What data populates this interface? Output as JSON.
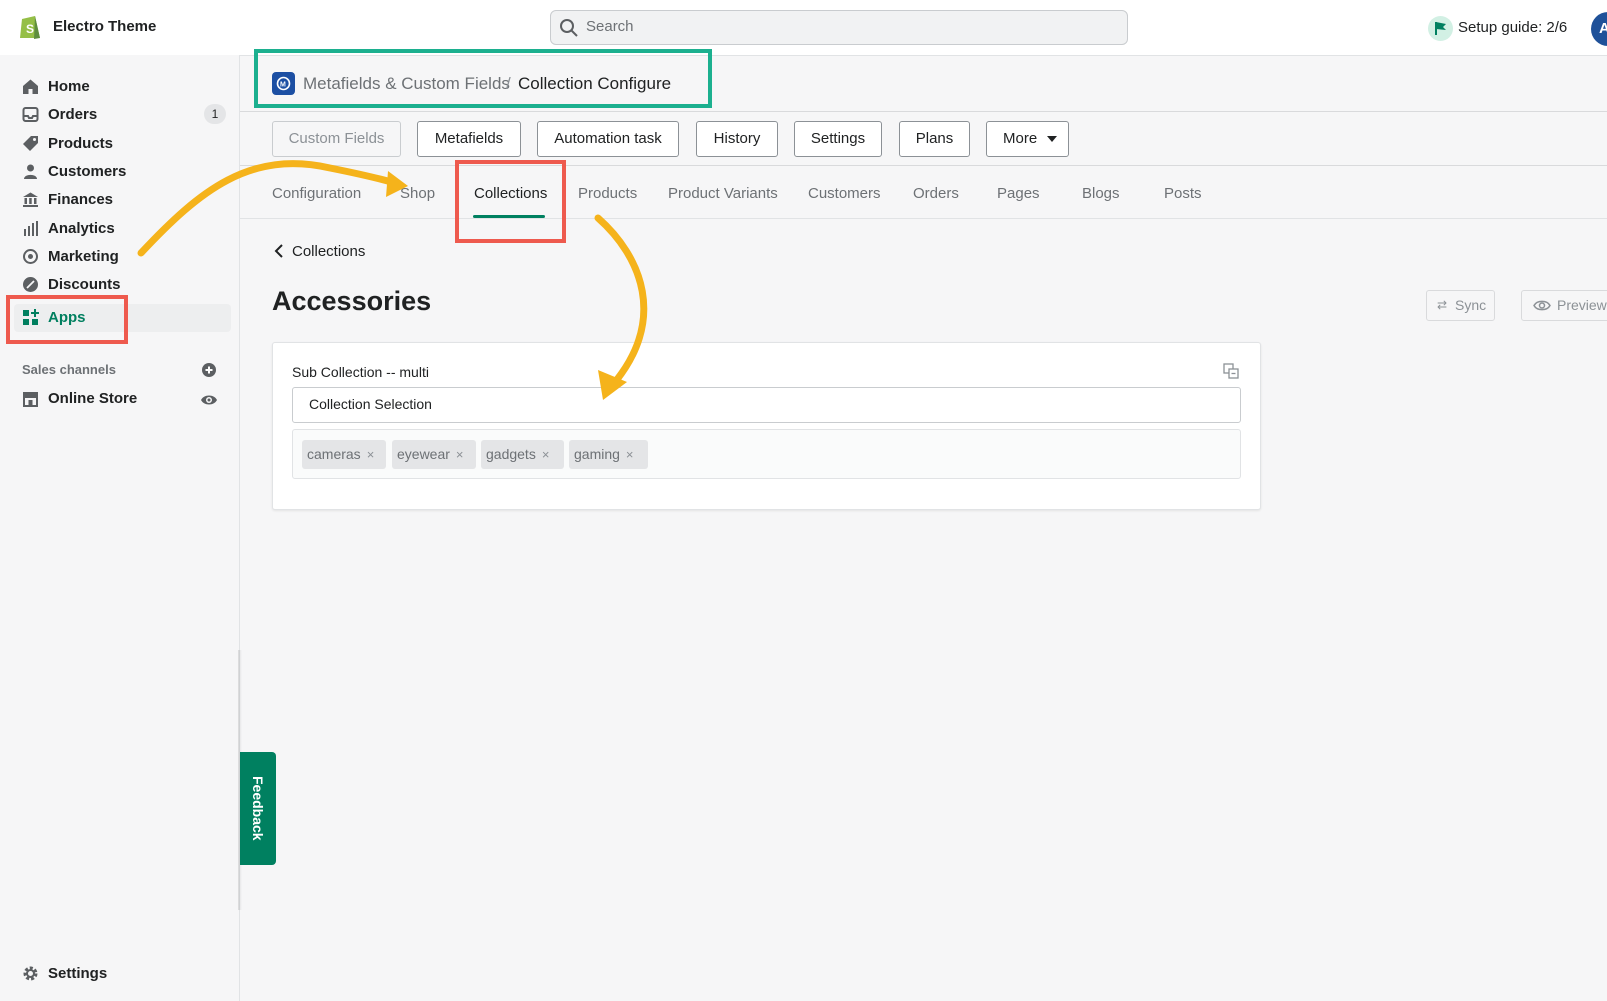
{
  "topbar": {
    "store_name": "Electro Theme",
    "search_placeholder": "Search",
    "setup_guide": "Setup guide: 2/6",
    "avatar_initial": "A"
  },
  "sidebar": {
    "items": [
      {
        "label": "Home",
        "icon": "home-icon"
      },
      {
        "label": "Orders",
        "icon": "orders-icon",
        "badge": "1"
      },
      {
        "label": "Products",
        "icon": "tag-icon"
      },
      {
        "label": "Customers",
        "icon": "person-icon"
      },
      {
        "label": "Finances",
        "icon": "bank-icon"
      },
      {
        "label": "Analytics",
        "icon": "bar-chart-icon"
      },
      {
        "label": "Marketing",
        "icon": "target-icon"
      },
      {
        "label": "Discounts",
        "icon": "discount-icon"
      },
      {
        "label": "Apps",
        "icon": "apps-icon",
        "active": true
      }
    ],
    "sales_channels_label": "Sales channels",
    "online_store": "Online Store",
    "settings": "Settings"
  },
  "titlebar": {
    "app_name": "Metafields & Custom Fields",
    "separator": "/",
    "page": "Collection Configure"
  },
  "toolbar": {
    "buttons": [
      "Custom Fields",
      "Metafields",
      "Automation task",
      "History",
      "Settings",
      "Plans",
      "More"
    ]
  },
  "tabs": [
    "Configuration",
    "Shop",
    "Collections",
    "Products",
    "Product Variants",
    "Customers",
    "Orders",
    "Pages",
    "Blogs",
    "Posts"
  ],
  "active_tab": "Collections",
  "content": {
    "back_label": "Collections",
    "title": "Accessories",
    "sync_label": "Sync",
    "preview_label": "Preview",
    "field_label": "Sub Collection -- multi",
    "selection_value": "Collection Selection",
    "tags": [
      "cameras",
      "eyewear",
      "gadgets",
      "gaming"
    ],
    "tag_remove": "×"
  },
  "feedback_label": "Feedback",
  "colors": {
    "accent_green": "#008060",
    "highlight_red": "#ee5a4e",
    "highlight_teal": "#1cb08f",
    "arrow_yellow": "#f5b31b"
  }
}
